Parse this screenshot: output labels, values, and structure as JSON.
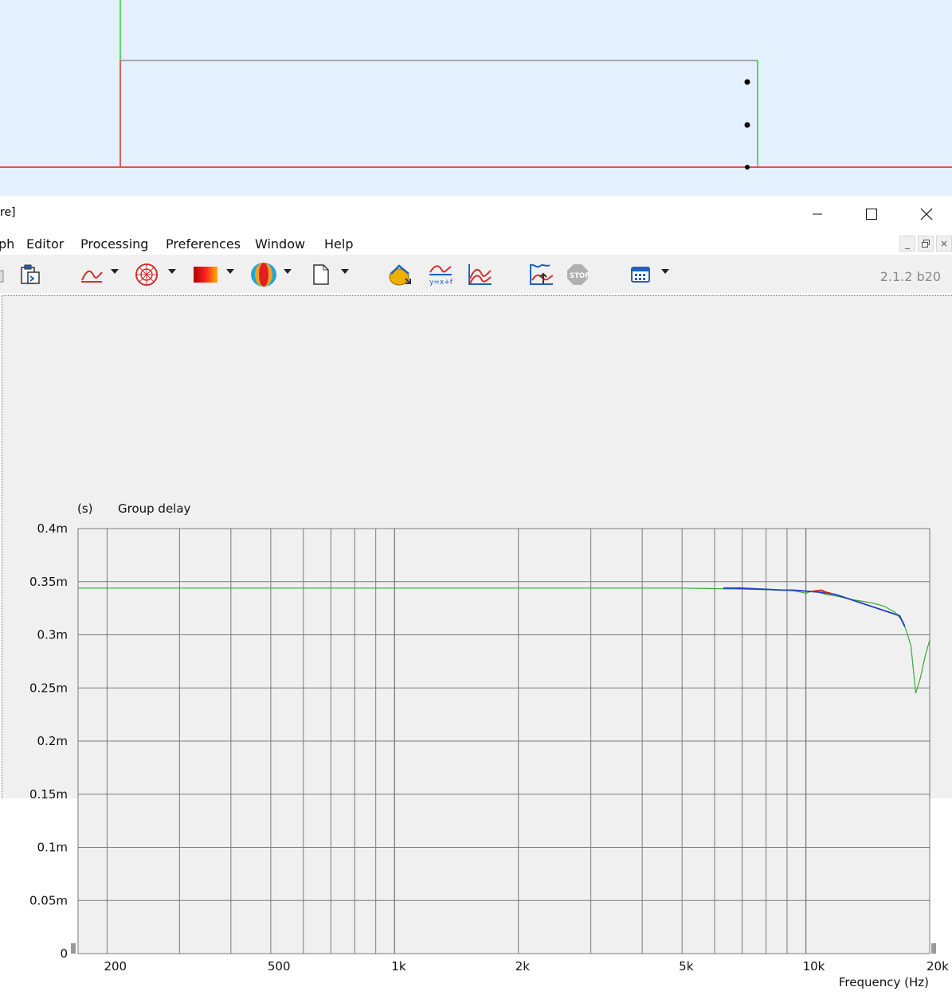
{
  "window": {
    "title_fragment": "re]",
    "controls": {
      "minimize": "minimize-icon",
      "maximize": "maximize-icon",
      "close": "close-icon"
    }
  },
  "menubar": {
    "items": [
      {
        "label": "ph"
      },
      {
        "label": "Editor"
      },
      {
        "label": "Processing"
      },
      {
        "label": "Preferences"
      },
      {
        "label": "Window"
      },
      {
        "label": "Help"
      }
    ],
    "mdi_controls": [
      "_",
      "æ",
      "×"
    ]
  },
  "toolbar": {
    "version": "2.1.2 b20",
    "icons": [
      "copy-icon",
      "clipboard-icon",
      "frequency-response-icon",
      "polar-icon",
      "sonogram-icon",
      "balloon-icon",
      "new-document-icon",
      "import-icon",
      "formula-icon",
      "multi-curve-icon",
      "waterfall-icon",
      "stop-icon",
      "calendar-icon"
    ]
  },
  "colors": {
    "canvas_bg": "#e3f0fd",
    "plot_bg": "#f0f0f0",
    "grid": "#7a7a7a",
    "trace_green": "#3aa83a",
    "trace_blue": "#2040c0",
    "trace_red": "#d02020"
  },
  "chart_data": {
    "type": "line",
    "title": "Group delay",
    "ylabel": "(s)",
    "xlabel": "Frequency  (Hz)",
    "x_scale": "log",
    "xlim": [
      170,
      20000
    ],
    "ylim": [
      0,
      0.0004
    ],
    "grid": true,
    "y_ticks": [
      {
        "value": 0,
        "label": "0"
      },
      {
        "value": 5e-05,
        "label": "0.05m"
      },
      {
        "value": 0.0001,
        "label": "0.1m"
      },
      {
        "value": 0.00015,
        "label": "0.15m"
      },
      {
        "value": 0.0002,
        "label": "0.2m"
      },
      {
        "value": 0.00025,
        "label": "0.25m"
      },
      {
        "value": 0.0003,
        "label": "0.3m"
      },
      {
        "value": 0.00035,
        "label": "0.35m"
      },
      {
        "value": 0.0004,
        "label": "0.4m"
      }
    ],
    "x_ticks": [
      {
        "value": 200,
        "label": "200"
      },
      {
        "value": 500,
        "label": "500"
      },
      {
        "value": 1000,
        "label": "1k"
      },
      {
        "value": 2000,
        "label": "2k"
      },
      {
        "value": 5000,
        "label": "5k"
      },
      {
        "value": 10000,
        "label": "10k"
      },
      {
        "value": 20000,
        "label": "20k"
      }
    ],
    "series": [
      {
        "color": "#3aa83a",
        "x": [
          170,
          1000,
          5000,
          7000,
          9000,
          9500,
          10000,
          10300,
          10700,
          11200,
          12000,
          13000,
          14500,
          15500,
          16500,
          17000,
          17500,
          18000,
          18500,
          19000,
          19500,
          20000
        ],
        "y": [
          0.000344,
          0.000344,
          0.000344,
          0.000343,
          0.000342,
          0.000341,
          0.000339,
          0.000341,
          0.00034,
          0.000338,
          0.000336,
          0.000333,
          0.00033,
          0.000327,
          0.000321,
          0.000315,
          0.000305,
          0.00029,
          0.000245,
          0.00026,
          0.00028,
          0.000295
        ]
      },
      {
        "color": "#2040c0",
        "x": [
          6300,
          6900,
          8800,
          9300,
          10900,
          11800,
          16900,
          17400
        ],
        "y": [
          0.000344,
          0.000344,
          0.000342,
          0.000342,
          0.00034,
          0.000338,
          0.000318,
          0.000308
        ]
      },
      {
        "color": "#d02020",
        "x": [
          10400,
          10900,
          11200,
          11500
        ],
        "y": [
          0.000341,
          0.000342,
          0.00034,
          0.000339
        ]
      }
    ]
  }
}
